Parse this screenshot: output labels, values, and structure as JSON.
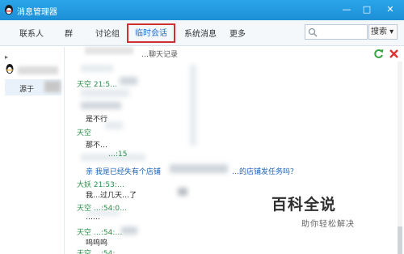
{
  "window": {
    "title": "消息管理器",
    "minimize_glyph": "—",
    "maximize_glyph": "□",
    "close_glyph": "✕"
  },
  "tabs": [
    {
      "label": "联系人",
      "active": false
    },
    {
      "label": "群",
      "active": false
    },
    {
      "label": "讨论组",
      "active": false
    },
    {
      "label": "临时会话",
      "active": true
    },
    {
      "label": "系统消息",
      "active": false
    },
    {
      "label": "更多",
      "active": false
    }
  ],
  "search": {
    "placeholder": "",
    "button_label": "搜索 ▾"
  },
  "sidebar": {
    "collapse_glyph": "▸",
    "selected_item_label": "源于"
  },
  "messages": {
    "header_fragment": "…聊天记录",
    "lines": [
      {
        "text": "天空 21:5…",
        "kind": "sender"
      },
      {
        "text": "是不行",
        "kind": "body"
      },
      {
        "text": "天空",
        "kind": "sender"
      },
      {
        "text": "那不…",
        "kind": "body"
      },
      {
        "text": "…:15",
        "kind": "sender"
      },
      {
        "text": "亲 我是已经失有个店铺",
        "kind": "blue"
      },
      {
        "text": "…的店铺发任务吗？",
        "kind": "blue"
      },
      {
        "text": "大妖 21:53:…",
        "kind": "sender"
      },
      {
        "text": "我…过几天…了",
        "kind": "body"
      },
      {
        "text": "天空 …:54:0…",
        "kind": "sender"
      },
      {
        "text": "……",
        "kind": "body"
      },
      {
        "text": "天空 …:54:…",
        "kind": "sender"
      },
      {
        "text": "呜呜呜",
        "kind": "body"
      },
      {
        "text": "天空 …:54:…",
        "kind": "sender"
      }
    ]
  },
  "watermark": {
    "title": "百科全说",
    "subtitle": "助你轻松解决"
  },
  "colors": {
    "titlebar": "#1d8fd6",
    "active_tab_border": "#d03030",
    "sender_green": "#2a8f4a",
    "message_blue": "#1b63b8"
  }
}
